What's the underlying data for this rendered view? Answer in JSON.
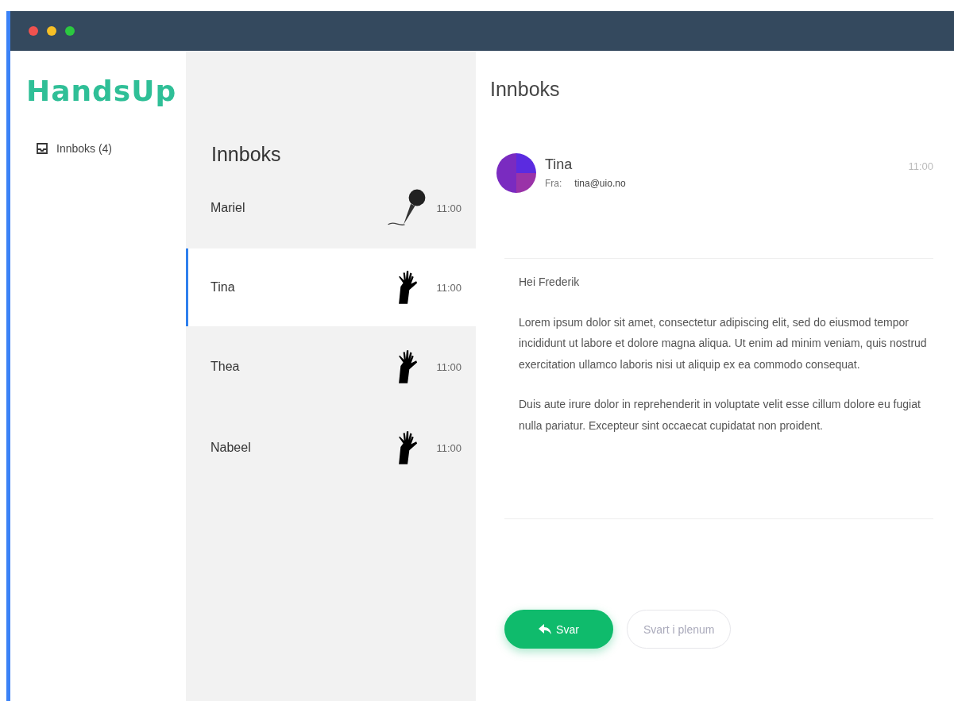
{
  "logo": "HandsUp",
  "sidebar": {
    "items": [
      {
        "label": "Innboks (4)"
      }
    ]
  },
  "list": {
    "title": "Innboks",
    "messages": [
      {
        "name": "Mariel",
        "kind": "microphone",
        "time": "11:00",
        "selected": false
      },
      {
        "name": "Tina",
        "kind": "hand",
        "time": "11:00",
        "selected": true
      },
      {
        "name": "Thea",
        "kind": "hand",
        "time": "11:00",
        "selected": false
      },
      {
        "name": "Nabeel",
        "kind": "hand",
        "time": "11:00",
        "selected": false
      }
    ]
  },
  "detail": {
    "title": "Innboks",
    "sender": "Tina",
    "from_label": "Fra:",
    "email": "tina@uio.no",
    "time": "11:00",
    "greeting": "Hei Frederik",
    "paragraphs": [
      "Lorem ipsum dolor sit amet, consectetur adipiscing elit, sed do eiusmod tempor incididunt ut labore et dolore magna aliqua. Ut enim ad minim veniam, quis nostrud exercitation ullamco laboris nisi ut aliquip ex ea commodo consequat.",
      "Duis aute irure dolor in reprehenderit in voluptate velit esse cillum dolore eu fugiat nulla pariatur. Excepteur sint occaecat cupidatat non proident."
    ],
    "buttons": [
      {
        "label": "Svar",
        "kind": "primary"
      },
      {
        "label": "Svart i plenum",
        "kind": "outline"
      }
    ]
  }
}
